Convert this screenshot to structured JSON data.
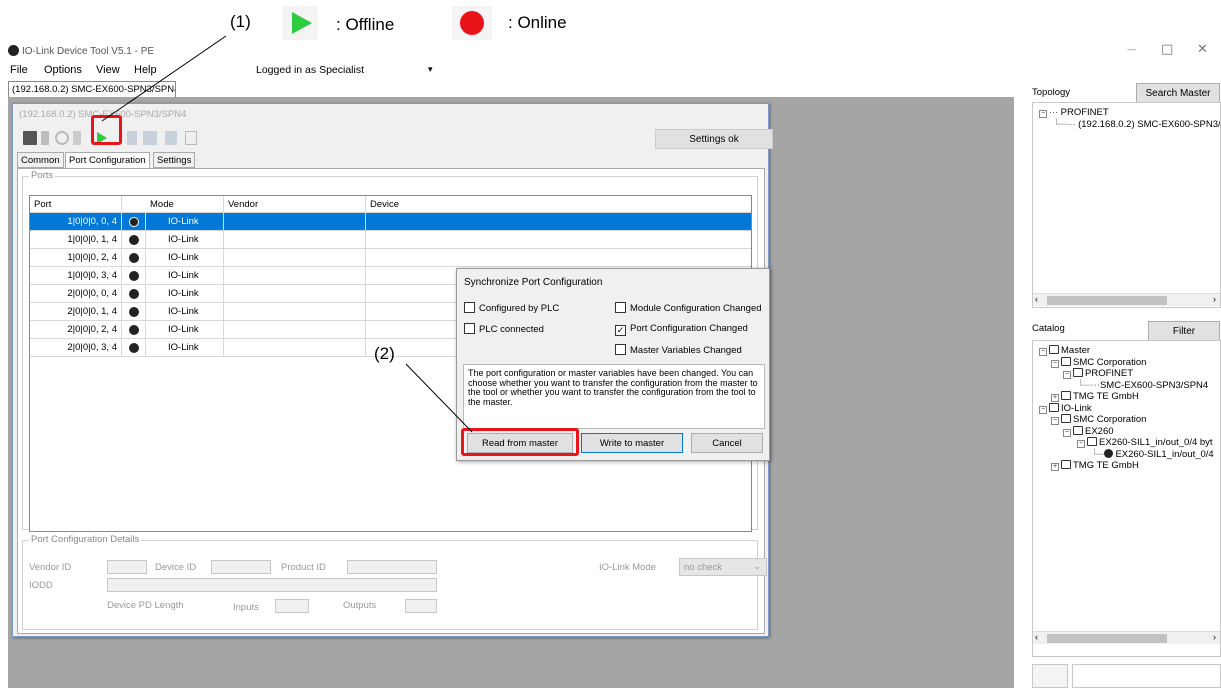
{
  "legend": {
    "num1": "(1)",
    "offline_label": ": Offline",
    "online_label": ": Online",
    "colors": {
      "offline": "#2ecc40",
      "online": "#e8141a",
      "highlight": "#e8141a"
    }
  },
  "window": {
    "title": "IO-Link Device Tool V5.1 - PE",
    "controls": {
      "minimize": "—",
      "maximize": "□",
      "close": "✕"
    }
  },
  "menu": {
    "items": [
      "File",
      "Options",
      "View",
      "Help"
    ],
    "logged_in_label": "Logged in as",
    "logged_in_user": "Specialist"
  },
  "device_tab": "(192.168.0.2) SMC-EX600-SPN3/SPN4",
  "device_window": {
    "title": "(192.168.0.2) SMC-EX600-SPN3/SPN4",
    "status": "Settings ok",
    "tabs": [
      "Common",
      "Port Configuration",
      "Settings"
    ],
    "ports_group": "Ports",
    "columns": [
      "Port",
      "Mode",
      "Vendor",
      "Device"
    ],
    "rows": [
      {
        "port": "1|0|0|0, 0, 4",
        "mode": "IO-Link",
        "vendor": "",
        "device": "",
        "selected": true
      },
      {
        "port": "1|0|0|0, 1, 4",
        "mode": "IO-Link",
        "vendor": "",
        "device": ""
      },
      {
        "port": "1|0|0|0, 2, 4",
        "mode": "IO-Link",
        "vendor": "",
        "device": ""
      },
      {
        "port": "1|0|0|0, 3, 4",
        "mode": "IO-Link",
        "vendor": "",
        "device": ""
      },
      {
        "port": "2|0|0|0, 0, 4",
        "mode": "IO-Link",
        "vendor": "",
        "device": ""
      },
      {
        "port": "2|0|0|0, 1, 4",
        "mode": "IO-Link",
        "vendor": "",
        "device": ""
      },
      {
        "port": "2|0|0|0, 2, 4",
        "mode": "IO-Link",
        "vendor": "",
        "device": ""
      },
      {
        "port": "2|0|0|0, 3, 4",
        "mode": "IO-Link",
        "vendor": "",
        "device": ""
      }
    ],
    "details": {
      "group": "Port Configuration Details",
      "vendor_id": "Vendor ID",
      "device_id": "Device ID",
      "product_id": "Product ID",
      "io_link_mode": "IO-Link Mode",
      "io_link_mode_value": "no check",
      "iodd": "IODD",
      "device_pd_length": "Device PD Length",
      "inputs": "Inputs",
      "outputs": "Outputs"
    }
  },
  "sync_dialog": {
    "title": "Synchronize Port Configuration",
    "checks": {
      "configured_by_plc": {
        "label": "Configured by PLC",
        "checked": false
      },
      "plc_connected": {
        "label": "PLC connected",
        "checked": false
      },
      "module_config_changed": {
        "label": "Module Configuration Changed",
        "checked": false
      },
      "port_config_changed": {
        "label": "Port Configuration Changed",
        "checked": true
      },
      "master_vars_changed": {
        "label": "Master Variables Changed",
        "checked": false
      }
    },
    "message": "The port configuration or master variables have been changed. You can choose whether you want to transfer the configuration from the master to the tool or whether you want to transfer the configuration from the tool to the master.",
    "buttons": {
      "read": "Read from master",
      "write": "Write to master",
      "cancel": "Cancel"
    },
    "annotation": "(2)"
  },
  "topology": {
    "label": "Topology",
    "search_button": "Search Master",
    "items": [
      "PROFINET",
      "(192.168.0.2) SMC-EX600-SPN3/S"
    ]
  },
  "catalog": {
    "label": "Catalog",
    "filter_button": "Filter",
    "items": [
      "Master",
      "SMC Corporation",
      "PROFINET",
      "SMC-EX600-SPN3/SPN4",
      "TMG TE GmbH",
      "IO-Link",
      "SMC Corporation",
      "EX260",
      "EX260-SIL1_in/out_0/4 byt",
      "EX260-SIL1_in/out_0/4",
      "TMG TE GmbH"
    ]
  }
}
